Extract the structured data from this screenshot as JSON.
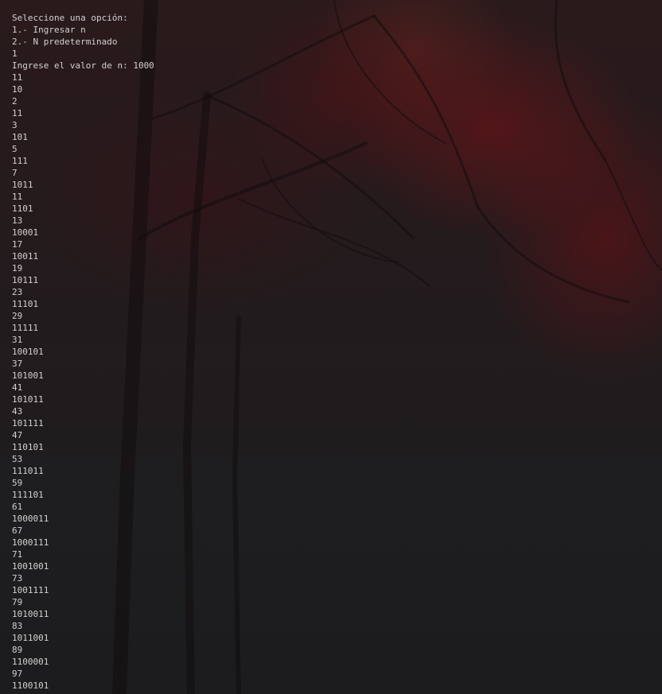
{
  "console": {
    "lines": [
      "Seleccione una opción:",
      "1.- Ingresar n",
      "2.- N predeterminado",
      "1",
      "Ingrese el valor de n: 1000",
      "11",
      "10",
      "2",
      "11",
      "3",
      "101",
      "5",
      "111",
      "7",
      "1011",
      "11",
      "1101",
      "13",
      "10001",
      "17",
      "10011",
      "19",
      "10111",
      "23",
      "11101",
      "29",
      "11111",
      "31",
      "100101",
      "37",
      "101001",
      "41",
      "101011",
      "43",
      "101111",
      "47",
      "110101",
      "53",
      "111011",
      "59",
      "111101",
      "61",
      "1000011",
      "67",
      "1000111",
      "71",
      "1001001",
      "73",
      "1001111",
      "79",
      "1010011",
      "83",
      "1011001",
      "89",
      "1100001",
      "97",
      "1100101"
    ]
  },
  "colors": {
    "text": "#d4d0d0",
    "background": "#1e1d1f",
    "accent_red": "#7a1216"
  }
}
